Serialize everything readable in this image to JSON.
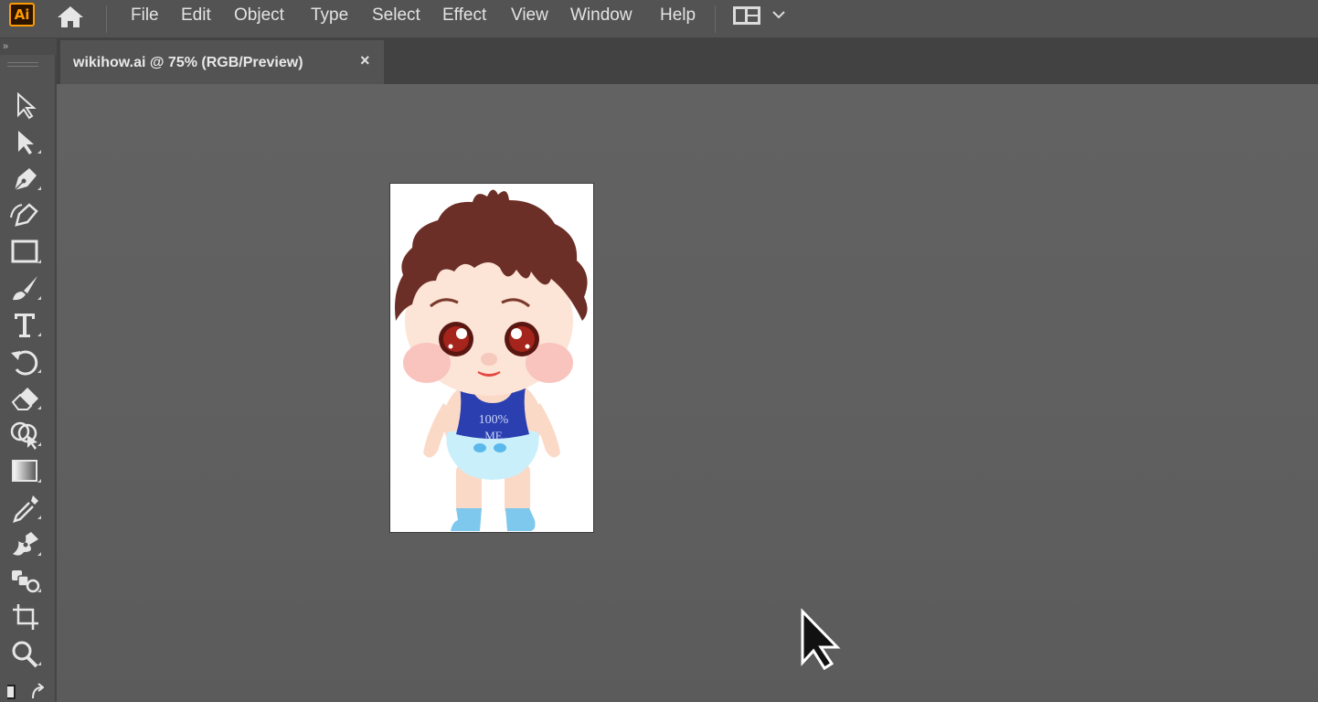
{
  "app": {
    "logo_text": "Ai"
  },
  "menu": {
    "items": [
      "File",
      "Edit",
      "Object",
      "Type",
      "Select",
      "Effect",
      "View",
      "Window",
      "Help"
    ]
  },
  "panel": {
    "collapse_label": "»"
  },
  "document": {
    "tab_title": "wikihow.ai @ 75% (RGB/Preview)",
    "close_label": "×"
  },
  "artwork": {
    "shirt_text_line1": "100%",
    "shirt_text_line2": "ME"
  },
  "tools": [
    "selection-tool-icon",
    "direct-selection-tool-icon",
    "pen-tool-icon",
    "curvature-tool-icon",
    "rectangle-tool-icon",
    "paintbrush-tool-icon",
    "type-tool-icon",
    "rotate-tool-icon",
    "eraser-tool-icon",
    "shape-builder-tool-icon",
    "gradient-tool-icon",
    "eyedropper-tool-icon",
    "blend-tool-icon",
    "symbol-sprayer-tool-icon",
    "artboard-tool-icon",
    "zoom-tool-icon"
  ],
  "colors": {
    "accent": "#ff9a00",
    "canvas": "#5e5e5e",
    "chrome": "#535353"
  }
}
